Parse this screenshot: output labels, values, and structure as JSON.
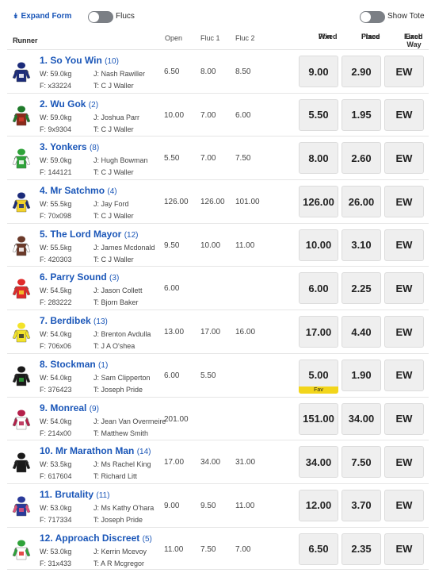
{
  "controls": {
    "expand_form": "Expand Form",
    "flucs": "Flucs",
    "show_tote": "Show Tote"
  },
  "header": {
    "runner": "Runner",
    "open": "Open",
    "fluc1": "Fluc 1",
    "fluc2": "Fluc 2",
    "win_line1": "Win",
    "win_line2": "Fixed",
    "place_line1": "Place",
    "place_line2": "Fixed",
    "ew_line1": "Each Way",
    "ew_line2": "Fixed"
  },
  "runners": [
    {
      "name": "1. So You Win",
      "barrier": "(10)",
      "weight": "W: 59.0kg",
      "jockey": "J: Nash Rawiller",
      "form": "F: x33224",
      "trainer": "T: C J Waller",
      "open": "6.50",
      "fluc1": "8.00",
      "fluc2": "8.50",
      "win": "9.00",
      "place": "2.90",
      "ew": "EW",
      "fav": "",
      "silk": {
        "body": "#1b2b7a",
        "sleeve": "#1b2b7a",
        "cap": "#1b2b7a",
        "accent": "#ffffff"
      }
    },
    {
      "name": "2. Wu Gok",
      "barrier": "(2)",
      "weight": "W: 59.0kg",
      "jockey": "J: Joshua Parr",
      "form": "F: 9x9304",
      "trainer": "T: C J Waller",
      "open": "10.00",
      "fluc1": "7.00",
      "fluc2": "6.00",
      "win": "5.50",
      "place": "1.95",
      "ew": "EW",
      "fav": "",
      "silk": {
        "body": "#8a2a1a",
        "sleeve": "#1f7a2a",
        "cap": "#1f7a2a",
        "accent": "#d23a2a"
      }
    },
    {
      "name": "3. Yonkers",
      "barrier": "(8)",
      "weight": "W: 59.0kg",
      "jockey": "J: Hugh Bowman",
      "form": "F: 144121",
      "trainer": "T: C J Waller",
      "open": "5.50",
      "fluc1": "7.00",
      "fluc2": "7.50",
      "win": "8.00",
      "place": "2.60",
      "ew": "EW",
      "fav": "",
      "silk": {
        "body": "#2fa33a",
        "sleeve": "#ffffff",
        "cap": "#2fa33a",
        "accent": "#ffffff"
      }
    },
    {
      "name": "4. Mr Satchmo",
      "barrier": "(4)",
      "weight": "W: 55.5kg",
      "jockey": "J: Jay Ford",
      "form": "F: 70x098",
      "trainer": "T: C J Waller",
      "open": "126.00",
      "fluc1": "126.00",
      "fluc2": "101.00",
      "win": "126.00",
      "place": "26.00",
      "ew": "EW",
      "fav": "",
      "silk": {
        "body": "#f3d22a",
        "sleeve": "#1b2b7a",
        "cap": "#1b2b7a",
        "accent": "#1b2b7a"
      }
    },
    {
      "name": "5. The Lord Mayor",
      "barrier": "(12)",
      "weight": "W: 55.5kg",
      "jockey": "J: James Mcdonald",
      "form": "F: 420303",
      "trainer": "T: C J Waller",
      "open": "9.50",
      "fluc1": "10.00",
      "fluc2": "11.00",
      "win": "10.00",
      "place": "3.10",
      "ew": "EW",
      "fav": "",
      "silk": {
        "body": "#6b3a2a",
        "sleeve": "#ffffff",
        "cap": "#6b3a2a",
        "accent": "#ffffff"
      }
    },
    {
      "name": "6. Parry Sound",
      "barrier": "(3)",
      "weight": "W: 54.5kg",
      "jockey": "J: Jason Collett",
      "form": "F: 283222",
      "trainer": "T: Bjorn Baker",
      "open": "6.00",
      "fluc1": "",
      "fluc2": "",
      "win": "6.00",
      "place": "2.25",
      "ew": "EW",
      "fav": "",
      "silk": {
        "body": "#e02a2a",
        "sleeve": "#e02a2a",
        "cap": "#e02a2a",
        "accent": "#f3d22a"
      }
    },
    {
      "name": "7. Berdibek",
      "barrier": "(13)",
      "weight": "W: 54.0kg",
      "jockey": "J: Brenton Avdulla",
      "form": "F: 706x06",
      "trainer": "T: J A O'shea",
      "open": "13.00",
      "fluc1": "17.00",
      "fluc2": "16.00",
      "win": "17.00",
      "place": "4.40",
      "ew": "EW",
      "fav": "",
      "silk": {
        "body": "#f3e32a",
        "sleeve": "#f3e32a",
        "cap": "#f3e32a",
        "accent": "#333333"
      }
    },
    {
      "name": "8. Stockman",
      "barrier": "(1)",
      "weight": "W: 54.0kg",
      "jockey": "J: Sam Clipperton",
      "form": "F: 376423",
      "trainer": "T: Joseph Pride",
      "open": "6.00",
      "fluc1": "5.50",
      "fluc2": "",
      "win": "5.00",
      "place": "1.90",
      "ew": "EW",
      "fav": "Fav",
      "silk": {
        "body": "#1a1a1a",
        "sleeve": "#1a1a1a",
        "cap": "#1a1a1a",
        "accent": "#2fa33a"
      }
    },
    {
      "name": "9. Monreal",
      "barrier": "(9)",
      "weight": "W: 54.0kg",
      "jockey": "J: Jean Van Overmeire",
      "form": "F: 214x00",
      "trainer": "T: Matthew Smith",
      "open": "201.00",
      "fluc1": "",
      "fluc2": "",
      "win": "151.00",
      "place": "34.00",
      "ew": "EW",
      "fav": "",
      "silk": {
        "body": "#ffffff",
        "sleeve": "#b51f4a",
        "cap": "#b51f4a",
        "accent": "#b51f4a"
      }
    },
    {
      "name": "10. Mr Marathon Man",
      "barrier": "(14)",
      "weight": "W: 53.5kg",
      "jockey": "J: Ms Rachel King",
      "form": "F: 617604",
      "trainer": "T: Richard Litt",
      "open": "17.00",
      "fluc1": "34.00",
      "fluc2": "31.00",
      "win": "34.00",
      "place": "7.50",
      "ew": "EW",
      "fav": "",
      "silk": {
        "body": "#1a1a1a",
        "sleeve": "#1a1a1a",
        "cap": "#1a1a1a",
        "accent": "#1a1a1a"
      }
    },
    {
      "name": "11. Brutality",
      "barrier": "(11)",
      "weight": "W: 53.0kg",
      "jockey": "J: Ms Kathy O'hara",
      "form": "F: 717334",
      "trainer": "T: Joseph Pride",
      "open": "9.00",
      "fluc1": "9.50",
      "fluc2": "11.00",
      "win": "12.00",
      "place": "3.70",
      "ew": "EW",
      "fav": "",
      "silk": {
        "body": "#2a3a9a",
        "sleeve": "#e0507a",
        "cap": "#2a3a9a",
        "accent": "#e0507a"
      }
    },
    {
      "name": "12. Approach Discreet",
      "barrier": "(5)",
      "weight": "W: 53.0kg",
      "jockey": "J: Kerrin Mcevoy",
      "form": "F: 31x433",
      "trainer": "T: A R Mcgregor",
      "open": "11.00",
      "fluc1": "7.50",
      "fluc2": "7.00",
      "win": "6.50",
      "place": "2.35",
      "ew": "EW",
      "fav": "",
      "silk": {
        "body": "#ffffff",
        "sleeve": "#2fa33a",
        "cap": "#2fa33a",
        "accent": "#e02a2a"
      }
    }
  ]
}
